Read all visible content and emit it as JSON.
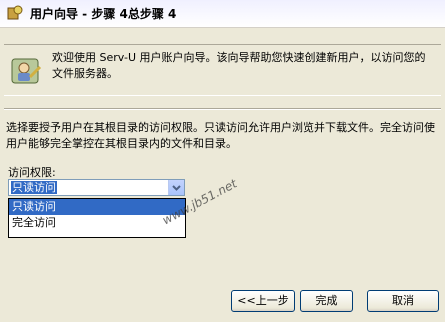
{
  "window": {
    "title": "用户向导 - 步骤 4总步骤 4"
  },
  "header": {
    "welcome": "欢迎使用 Serv-U 用户账户向导。该向导帮助您快速创建新用户，以访问您的文件服务器。"
  },
  "description": "选择要授予用户在其根目录的访问权限。只读访问允许用户浏览并下载文件。完全访问使用户能够完全掌控在其根目录内的文件和目录。",
  "access": {
    "label": "访问权限:",
    "selected": "只读访问",
    "options": [
      "只读访问",
      "完全访问"
    ]
  },
  "buttons": {
    "back": "<<上一步",
    "finish": "完成",
    "cancel": "取消"
  },
  "watermark": "www.jb51.net"
}
